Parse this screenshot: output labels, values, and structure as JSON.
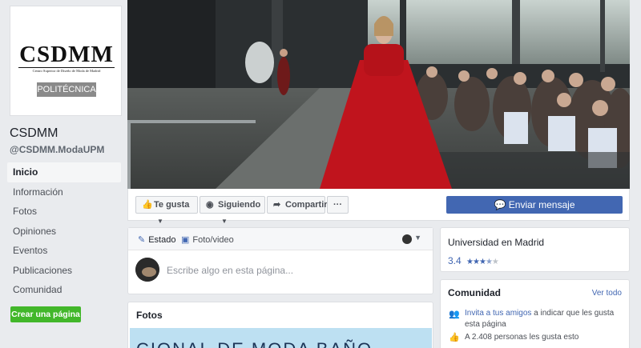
{
  "profile": {
    "logo_text": "CSDMM",
    "logo_subtitle": "Centro Superior de Diseño de Moda de Madrid",
    "logo_badge": "POLITÉCNICA"
  },
  "page": {
    "name": "CSDMM",
    "handle": "@CSDMM.ModaUPM"
  },
  "nav": {
    "items": [
      {
        "label": "Inicio"
      },
      {
        "label": "Información"
      },
      {
        "label": "Fotos"
      },
      {
        "label": "Opiniones"
      },
      {
        "label": "Eventos"
      },
      {
        "label": "Publicaciones"
      },
      {
        "label": "Comunidad"
      }
    ],
    "create_page": "Crear una página"
  },
  "actions": {
    "like": "Te gusta",
    "following": "Siguiendo",
    "share": "Compartir",
    "more": "···",
    "send_message": "Enviar mensaje"
  },
  "composer": {
    "tab_status": "Estado",
    "tab_photo": "Foto/video",
    "placeholder": "Escribe algo en esta página..."
  },
  "photos": {
    "title": "Fotos",
    "banner_text": "CIONAL DE MODA BAÑO"
  },
  "about": {
    "category": "Universidad en Madrid",
    "rating": "3.4",
    "stars_filled": 3.5,
    "stars_total": 5
  },
  "community": {
    "title": "Comunidad",
    "see_all": "Ver todo",
    "invite_link": "Invita a tus amigos",
    "invite_rest": " a indicar que les gusta esta página",
    "likes_text": "A 2.408 personas les gusta esto"
  },
  "colors": {
    "brand_blue": "#4267b2",
    "create_green": "#42b72a",
    "background": "#e9ebee"
  }
}
